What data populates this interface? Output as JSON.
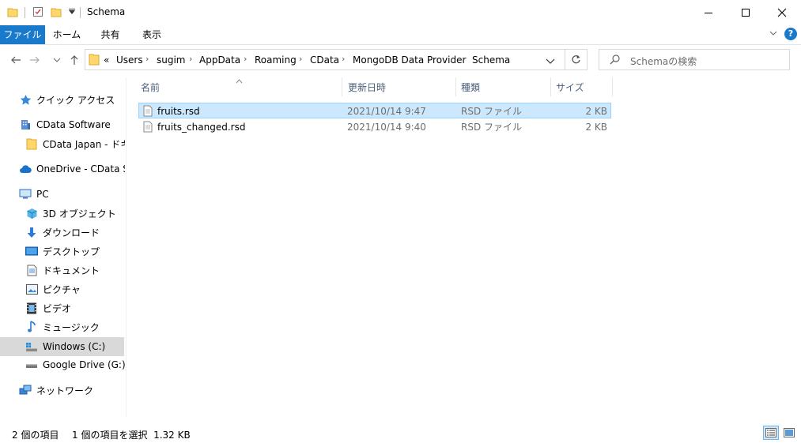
{
  "window": {
    "title": "Schema"
  },
  "ribbon": {
    "tabs": [
      {
        "label": "ファイル"
      },
      {
        "label": "ホーム"
      },
      {
        "label": "共有"
      },
      {
        "label": "表示"
      }
    ]
  },
  "address": {
    "overflow": "«",
    "crumbs": [
      "Users",
      "sugim",
      "AppData",
      "Roaming",
      "CData",
      "MongoDB Data Provider",
      "Schema"
    ]
  },
  "search": {
    "placeholder": "Schemaの検索"
  },
  "columns": {
    "name": "名前",
    "date": "更新日時",
    "type": "種類",
    "size": "サイズ"
  },
  "sidebar": {
    "items": [
      {
        "label": "クイック アクセス",
        "icon": "star-icon"
      },
      {
        "label": "CData Software",
        "icon": "building-icon"
      },
      {
        "label": "CData Japan - ドキュメント",
        "icon": "folder-icon"
      },
      {
        "label": "OneDrive - CData Software",
        "icon": "cloud-icon"
      },
      {
        "label": "PC",
        "icon": "pc-icon"
      },
      {
        "label": "3D オブジェクト",
        "icon": "cube-icon"
      },
      {
        "label": "ダウンロード",
        "icon": "download-icon"
      },
      {
        "label": "デスクトップ",
        "icon": "desktop-icon"
      },
      {
        "label": "ドキュメント",
        "icon": "document-icon"
      },
      {
        "label": "ピクチャ",
        "icon": "picture-icon"
      },
      {
        "label": "ビデオ",
        "icon": "video-icon"
      },
      {
        "label": "ミュージック",
        "icon": "music-icon"
      },
      {
        "label": "Windows (C:)",
        "icon": "drive-icon"
      },
      {
        "label": "Google Drive (G:)",
        "icon": "drive-icon"
      },
      {
        "label": "ネットワーク",
        "icon": "network-icon"
      }
    ]
  },
  "files": [
    {
      "name": "fruits.rsd",
      "date": "2021/10/14 9:47",
      "type": "RSD ファイル",
      "size": "2 KB",
      "selected": true
    },
    {
      "name": "fruits_changed.rsd",
      "date": "2021/10/14 9:40",
      "type": "RSD ファイル",
      "size": "2 KB",
      "selected": false
    }
  ],
  "status": {
    "count": "2 個の項目",
    "selection": "1 個の項目を選択  1.32 KB"
  },
  "colors": {
    "accent": "#1979ca",
    "selection": "#cce8ff",
    "selection_border": "#99d1ff",
    "folder": "#ffd76b",
    "header_text": "#4c607a"
  }
}
